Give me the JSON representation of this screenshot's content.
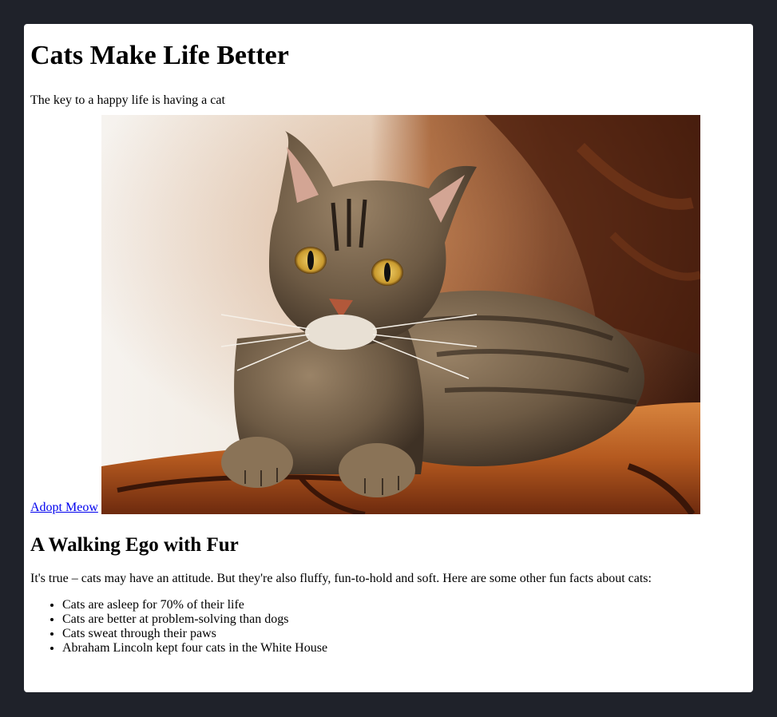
{
  "page": {
    "title": "Cats Make Life Better",
    "subtitle": "The key to a happy life is having a cat",
    "link_label": "Adopt Meow",
    "section_heading": "A Walking Ego with Fur",
    "intro": "It's true – cats may have an attitude. But they're also fluffy, fun-to-hold and soft. Here are some other fun facts about cats:",
    "facts": [
      "Cats are asleep for 70% of their life",
      "Cats are better at problem-solving than dogs",
      "Cats sweat through their paws",
      "Abraham Lincoln kept four cats in the White House"
    ]
  },
  "colors": {
    "page_background": "#1f222a",
    "card_background": "#ffffff",
    "link": "#0000ee"
  },
  "image": {
    "subject": "tabby-cat-on-orange-cushion"
  }
}
